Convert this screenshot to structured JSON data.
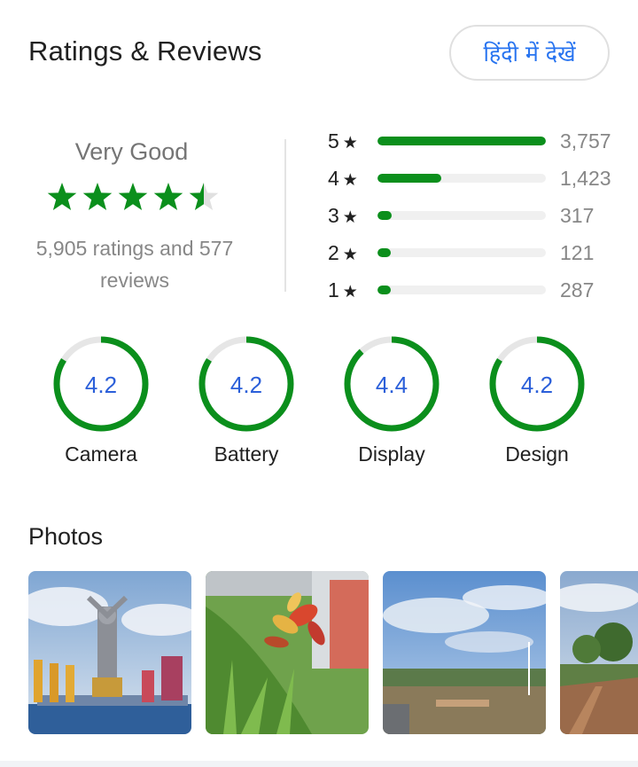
{
  "header": {
    "title": "Ratings & Reviews",
    "hindi_button": "हिंदी में देखें"
  },
  "summary": {
    "rating_word": "Very Good",
    "stars_value": 4.5,
    "ratings_reviews_line1": "5,905 ratings and 577",
    "ratings_reviews_line2": "reviews",
    "star_color": "#0b8f1c"
  },
  "distribution": [
    {
      "stars": "5",
      "star_glyph": "★",
      "count": "3,757",
      "fraction": 1.0
    },
    {
      "stars": "4",
      "star_glyph": "★",
      "count": "1,423",
      "fraction": 0.38
    },
    {
      "stars": "3",
      "star_glyph": "★",
      "count": "317",
      "fraction": 0.084
    },
    {
      "stars": "2",
      "star_glyph": "★",
      "count": "121",
      "fraction": 0.032
    },
    {
      "stars": "1",
      "star_glyph": "★",
      "count": "287",
      "fraction": 0.076
    }
  ],
  "aspects": [
    {
      "name": "Camera",
      "value": "4.2",
      "fraction": 0.84
    },
    {
      "name": "Battery",
      "value": "4.2",
      "fraction": 0.84
    },
    {
      "name": "Display",
      "value": "4.4",
      "fraction": 0.88
    },
    {
      "name": "Design",
      "value": "4.2",
      "fraction": 0.84
    }
  ],
  "colors": {
    "accent_green": "#0b8f1c",
    "link_blue": "#2874f0",
    "aspect_value_blue": "#2b5fd9",
    "track_gray": "#e6e6e6"
  },
  "photos": {
    "title": "Photos",
    "items": [
      {
        "name": "photo-statue"
      },
      {
        "name": "photo-grass-plant"
      },
      {
        "name": "photo-sky-field"
      },
      {
        "name": "photo-farm-trees"
      }
    ]
  }
}
